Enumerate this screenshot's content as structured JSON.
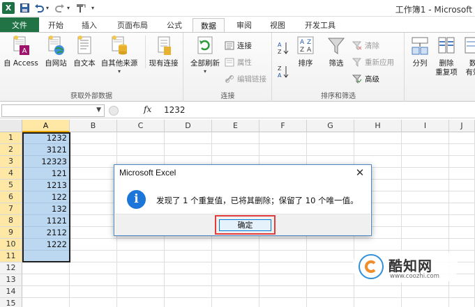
{
  "window": {
    "app_logo": "X",
    "title": "工作簿1 - Microsoft"
  },
  "quick_access": {
    "save_icon": "save-icon",
    "undo_icon": "undo-icon",
    "redo_icon": "redo-icon",
    "custom_icon": "format-painter-icon"
  },
  "tabs": [
    {
      "label": "文件"
    },
    {
      "label": "开始"
    },
    {
      "label": "插入"
    },
    {
      "label": "页面布局"
    },
    {
      "label": "公式"
    },
    {
      "label": "数据"
    },
    {
      "label": "审阅"
    },
    {
      "label": "视图"
    },
    {
      "label": "开发工具"
    }
  ],
  "active_tab": "数据",
  "ribbon": {
    "get_external": {
      "label": "获取外部数据",
      "buttons": [
        {
          "label": "自 Access"
        },
        {
          "label": "自网站"
        },
        {
          "label": "自文本"
        },
        {
          "label": "自其他来源"
        },
        {
          "label": "现有连接"
        }
      ]
    },
    "connections": {
      "label": "连接",
      "refresh_all": "全部刷新",
      "small": [
        {
          "label": "连接"
        },
        {
          "label": "属性"
        },
        {
          "label": "编辑链接"
        }
      ]
    },
    "sort_filter": {
      "label": "排序和筛选",
      "sort": "排序",
      "filter": "筛选",
      "small": [
        {
          "label": "清除"
        },
        {
          "label": "重新应用"
        },
        {
          "label": "高级"
        }
      ]
    },
    "tools": {
      "split": "分列",
      "remove_dup_line1": "删除",
      "remove_dup_line2": "重复项",
      "validation_line1": "数",
      "validation_line2": "有效"
    }
  },
  "formula_bar": {
    "name_box": "",
    "fx": "fx",
    "value": "1232"
  },
  "columns": [
    "A",
    "B",
    "C",
    "D",
    "E",
    "F",
    "G",
    "H",
    "I",
    "J"
  ],
  "rows": [
    "1",
    "2",
    "3",
    "4",
    "5",
    "6",
    "7",
    "8",
    "9",
    "10",
    "11",
    "12",
    "13",
    "14",
    "15"
  ],
  "column_a_values": [
    "1232",
    "3121",
    "12323",
    "121",
    "1213",
    "122",
    "132",
    "1121",
    "2112",
    "1222",
    ""
  ],
  "dialog": {
    "title": "Microsoft Excel",
    "close": "✕",
    "icon": "i",
    "message": "发现了 1 个重复值，已将其删除；保留了 10 个唯一值。",
    "ok_label": "确定",
    "highlight_color": "#e23b3b"
  },
  "watermark": {
    "title": "酷知网",
    "url": "www.coozhi.com"
  },
  "colors": {
    "file_tab": "#217346",
    "selection": "#bcd7f0",
    "info_icon": "#1c75d8"
  }
}
